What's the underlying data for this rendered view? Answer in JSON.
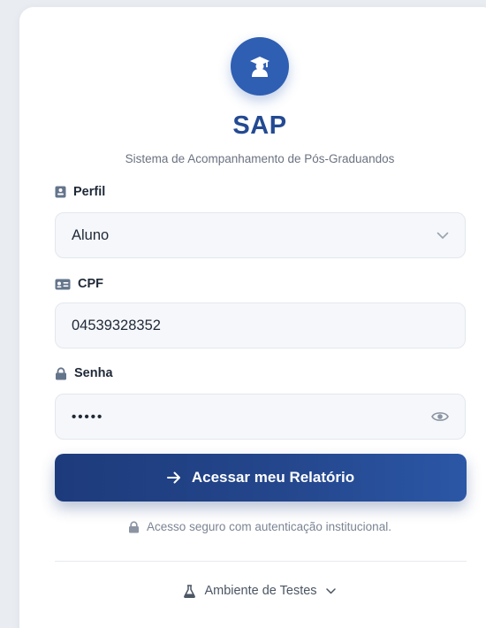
{
  "app": {
    "title": "SAP",
    "subtitle": "Sistema de Acompanhamento de Pós-Graduandos"
  },
  "form": {
    "profile": {
      "label": "Perfil",
      "selected": "Aluno"
    },
    "cpf": {
      "label": "CPF",
      "value": "04539328352"
    },
    "password": {
      "label": "Senha",
      "masked_value": "•••••"
    },
    "submit_label": "Acessar meu Relatório"
  },
  "footer": {
    "secure_note": "Acesso seguro com autenticação institucional.",
    "environment_label": "Ambiente de Testes"
  },
  "icons": {
    "logo": "graduate-icon",
    "profile": "id-badge-icon",
    "cpf": "id-card-icon",
    "password": "lock-icon",
    "select": "chevron-down-icon",
    "reveal": "eye-icon",
    "submit": "arrow-right-icon",
    "secure": "lock-icon",
    "environment": "flask-icon"
  },
  "colors": {
    "brand": "#234a92",
    "logo_bg": "#2f5fb3",
    "button_start": "#1d3b7c",
    "button_end": "#2b57a6",
    "page_bg": "#e9edf2"
  }
}
